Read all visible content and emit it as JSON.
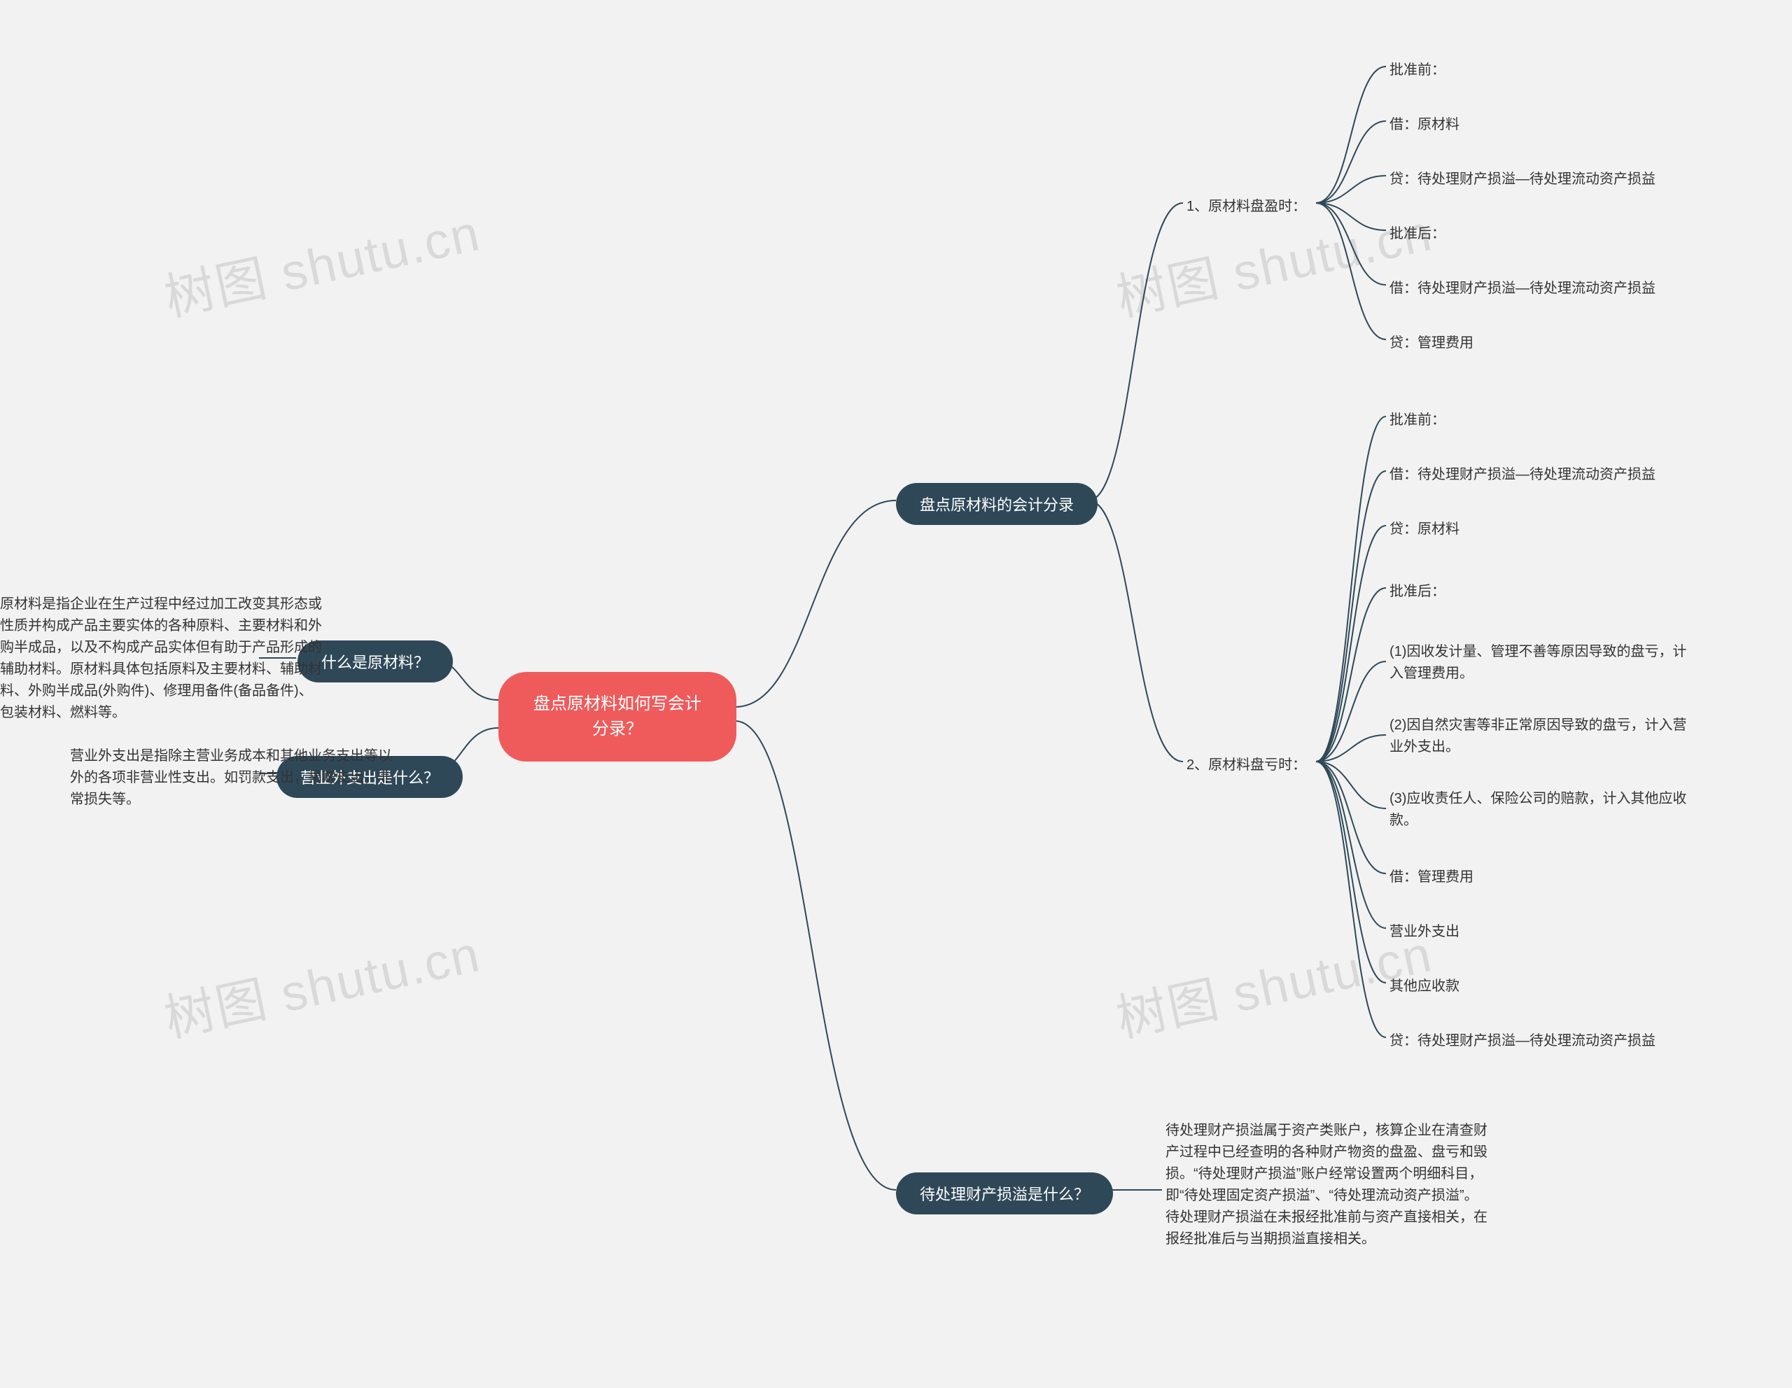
{
  "root": {
    "title": "盘点原材料如何写会计分录？"
  },
  "branches": {
    "entries": {
      "label": "盘点原材料的会计分录"
    },
    "pendingLoss": {
      "label": "待处理财产损溢是什么？"
    },
    "rawMaterial": {
      "label": "什么是原材料？"
    },
    "nonOperating": {
      "label": "营业外支出是什么？"
    }
  },
  "entries": {
    "surplus": {
      "title": "1、原材料盘盈时：",
      "items": [
        "批准前：",
        "借：原材料",
        "贷：待处理财产损溢—待处理流动资产损益",
        "批准后：",
        "借：待处理财产损溢—待处理流动资产损益",
        "贷：管理费用"
      ]
    },
    "shortage": {
      "title": "2、原材料盘亏时：",
      "items": [
        "批准前：",
        "借：待处理财产损溢—待处理流动资产损益",
        "贷：原材料",
        "批准后：",
        "(1)因收发计量、管理不善等原因导致的盘亏，计入管理费用。",
        "(2)因自然灾害等非正常原因导致的盘亏，计入营业外支出。",
        "(3)应收责任人、保险公司的赔款，计入其他应收款。",
        "借：管理费用",
        "营业外支出",
        "其他应收款",
        "贷：待处理财产损溢—待处理流动资产损益"
      ]
    }
  },
  "pendingLossDesc": "待处理财产损溢属于资产类账户，核算企业在清查财产过程中已经查明的各种财产物资的盘盈、盘亏和毁损。“待处理财产损溢”账户经常设置两个明细科目，即“待处理固定资产损溢”、“待处理流动资产损溢”。待处理财产损溢在未报经批准前与资产直接相关，在报经批准后与当期损溢直接相关。",
  "rawMaterialDesc": "原材料是指企业在生产过程中经过加工改变其形态或性质并构成产品主要实体的各种原料、主要材料和外购半成品，以及不构成产品实体但有助于产品形成的辅助材料。原材料具体包括原料及主要材料、辅助材料、外购半成品(外购件)、修理用备件(备品备件)、包装材料、燃料等。",
  "nonOperatingDesc": "营业外支出是指除主营业务成本和其他业务支出等以外的各项非营业性支出。如罚款支出，捐赠支出，非常损失等。",
  "watermark": "树图 shutu.cn"
}
